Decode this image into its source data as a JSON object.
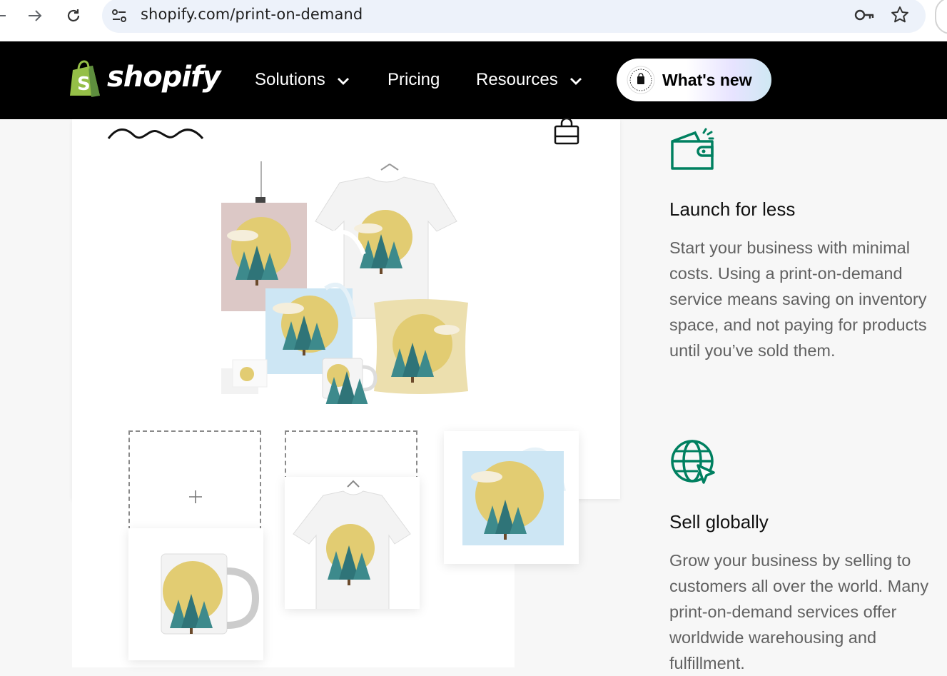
{
  "browser": {
    "url": "shopify.com/print-on-demand",
    "icons": [
      "back-arrow-icon",
      "forward-arrow-icon",
      "reload-icon",
      "site-info-icon",
      "key-icon",
      "star-icon"
    ]
  },
  "nav": {
    "logo_text": "shopify",
    "items": [
      {
        "label": "Solutions",
        "has_dropdown": true
      },
      {
        "label": "Pricing",
        "has_dropdown": false
      },
      {
        "label": "Resources",
        "has_dropdown": true
      }
    ],
    "whats_new": "What's new",
    "colors": {
      "background": "#000000",
      "brand_green": "#95bf47",
      "accent": "#008060"
    }
  },
  "features": [
    {
      "icon": "wallet-icon",
      "title": "Launch for less",
      "body": "Start your business with minimal costs. Using a print-on-demand service means saving on inventory space, and not paying for products until you’ve sold them."
    },
    {
      "icon": "globe-cursor-icon",
      "title": "Sell globally",
      "body": "Grow your business by selling to customers all over the world. Many print-on-demand services offer worldwide warehousing and fulfillment."
    }
  ]
}
